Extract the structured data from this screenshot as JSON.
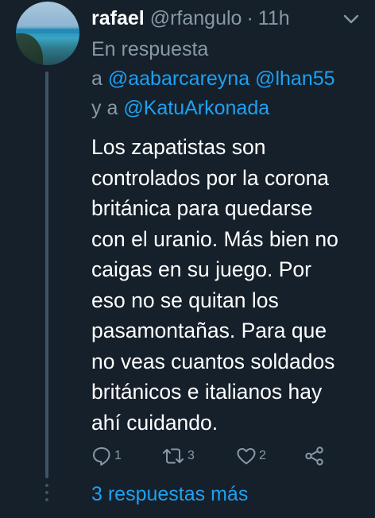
{
  "tweet": {
    "display_name": "rafael",
    "handle": "@rfangulo",
    "separator": "·",
    "time": "11h",
    "reply_context": {
      "prefix": "En respuesta",
      "a": "a",
      "mention1": "@aabarcareyna",
      "mention2": "@lhan55",
      "conj": "y a",
      "mention3": "@KatuArkonada"
    },
    "body_lines": [
      "Los zapatistas son",
      "controlados por la corona",
      "británica para quedarse",
      "con el uranio. Más bien no",
      "caigas en su juego. Por",
      "eso no se quitan los",
      "pasamontañas. Para que",
      "no veas cuantos soldados",
      "británicos e italianos hay",
      "ahí cuidando."
    ],
    "actions": {
      "reply_count": "1",
      "retweet_count": "3",
      "like_count": "2"
    }
  },
  "more_replies_label": "3 respuestas más",
  "icons": {
    "avatar": "avatar",
    "caret": "chevron-down-icon",
    "reply": "reply-icon",
    "retweet": "retweet-icon",
    "like": "heart-icon",
    "share": "share-icon"
  },
  "colors": {
    "background": "#15202b",
    "primary_text": "#ffffff",
    "secondary_text": "#8899a6",
    "accent": "#1da1f2",
    "thread_line": "#3d5466"
  }
}
